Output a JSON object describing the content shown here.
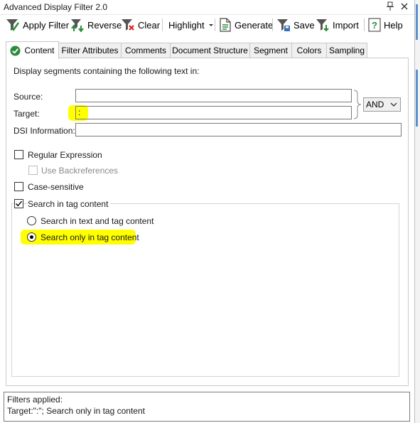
{
  "window": {
    "title": "Advanced Display Filter 2.0"
  },
  "toolbar": {
    "apply_filter": "Apply Filter",
    "reverse": "Reverse",
    "clear": "Clear",
    "highlight": "Highlight",
    "generate": "Generate",
    "save": "Save",
    "import": "Import",
    "help": "Help"
  },
  "tabs": [
    {
      "label": "Content"
    },
    {
      "label": "Filter Attributes"
    },
    {
      "label": "Comments"
    },
    {
      "label": "Document Structure"
    },
    {
      "label": "Segment"
    },
    {
      "label": "Colors"
    },
    {
      "label": "Sampling"
    }
  ],
  "content": {
    "heading": "Display segments containing the following text in:",
    "source_label": "Source:",
    "source_value": "",
    "target_label": "Target:",
    "target_value": ":",
    "dsi_label": "DSI Information:",
    "dsi_value": "",
    "operator": "AND",
    "regex_label": "Regular Expression",
    "backrefs_label": "Use Backreferences",
    "case_label": "Case-sensitive",
    "tag_label": "Search in tag content",
    "radio_text_and_tag": "Search in text and tag content",
    "radio_only_tag": "Search only in tag content"
  },
  "status": {
    "title": "Filters applied:",
    "detail": "Target:\":\"; Search only in tag content"
  },
  "colors": {
    "highlight": "#ffff00",
    "accent": "#2c8a3a",
    "tab_border": "#c8c8c8"
  }
}
